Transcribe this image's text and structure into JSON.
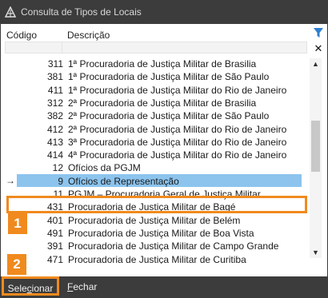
{
  "window": {
    "title": "Consulta de Tipos de Locais"
  },
  "header": {
    "code_label": "Código",
    "desc_label": "Descrição"
  },
  "rows": [
    {
      "code": "311",
      "desc": "1ª Procuradoria de Justiça Militar de Brasilia",
      "selected": false
    },
    {
      "code": "381",
      "desc": "1ª Procuradoria de Justiça Militar de São Paulo",
      "selected": false
    },
    {
      "code": "411",
      "desc": "1ª Procuradoria de Justiça Militar do Rio de Janeiro",
      "selected": false
    },
    {
      "code": "312",
      "desc": "2ª Procuradoria de Justiça Militar de Brasilia",
      "selected": false
    },
    {
      "code": "382",
      "desc": "2ª Procuradoria de Justiça Militar de São Paulo",
      "selected": false
    },
    {
      "code": "412",
      "desc": "2ª Procuradoria de Justiça Militar do Rio de Janeiro",
      "selected": false
    },
    {
      "code": "413",
      "desc": "3ª Procuradoria de Justiça Militar do Rio de Janeiro",
      "selected": false
    },
    {
      "code": "414",
      "desc": "4ª Procuradoria de Justiça Militar do Rio de Janeiro",
      "selected": false
    },
    {
      "code": "12",
      "desc": "Ofícios da PGJM",
      "selected": false
    },
    {
      "code": "9",
      "desc": "Ofícios de Representação",
      "selected": true
    },
    {
      "code": "11",
      "desc": "PGJM – Procuradoria Geral de Justiça Militar",
      "selected": false
    },
    {
      "code": "431",
      "desc": "Procuradoria de Justiça Militar de Bagé",
      "selected": false
    },
    {
      "code": "401",
      "desc": "Procuradoria de Justiça Militar de Belém",
      "selected": false
    },
    {
      "code": "491",
      "desc": "Procuradoria de Justiça Militar de Boa Vista",
      "selected": false
    },
    {
      "code": "391",
      "desc": "Procuradoria de Justiça Militar de Campo Grande",
      "selected": false
    },
    {
      "code": "471",
      "desc": "Procuradoria de Justiça Militar de Curitiba",
      "selected": false
    }
  ],
  "row_indicator": "→",
  "badges": {
    "one": "1",
    "two": "2"
  },
  "footer": {
    "select_pre": "Sele",
    "select_ul": "c",
    "select_post": "ionar",
    "close_ul": "F",
    "close_post": "echar"
  },
  "colors": {
    "accent": "#f08a1e",
    "selection": "#8cc4ee",
    "chrome": "#3c3c3c"
  }
}
